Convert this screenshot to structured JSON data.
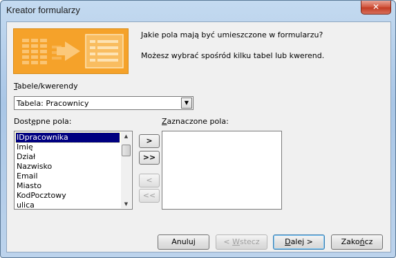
{
  "window": {
    "title": "Kreator formularzy",
    "close_glyph": "✕"
  },
  "header": {
    "question": "Jakie pola mają być umieszczone w formularzu?",
    "subtext": "Możesz wybrać spośród kilku tabel lub kwerend."
  },
  "source": {
    "label_prefix": "T",
    "label_rest": "abele/kwerendy",
    "selected": "Tabela: Pracownicy",
    "dropdown_glyph": "▼"
  },
  "available": {
    "label_prefix": "Dost",
    "label_u": "ę",
    "label_rest": "pne pola:",
    "items": [
      "IDpracownika",
      "Imię",
      "Dział",
      "Nazwisko",
      "Email",
      "Miasto",
      "KodPocztowy",
      "ulica"
    ],
    "selected_index": 0
  },
  "selected_fields": {
    "label_u": "Z",
    "label_rest": "aznaczone pola:",
    "items": []
  },
  "move_buttons": {
    "add_one": ">",
    "add_all": ">>",
    "remove_one": "<",
    "remove_all": "<<"
  },
  "footer": {
    "cancel": "Anuluj",
    "back_prefix": "< ",
    "back_u": "W",
    "back_rest": "stecz",
    "next_u": "D",
    "next_rest": "alej >",
    "finish_prefix": "Zako",
    "finish_u": "ń",
    "finish_rest": "cz"
  },
  "colors": {
    "banner": "#f5a22a",
    "selection": "#000080"
  },
  "icons": {
    "banner": "form-wizard-illustration-icon",
    "scroll_up": "scroll-up-arrow-icon",
    "scroll_down": "scroll-down-arrow-icon"
  }
}
